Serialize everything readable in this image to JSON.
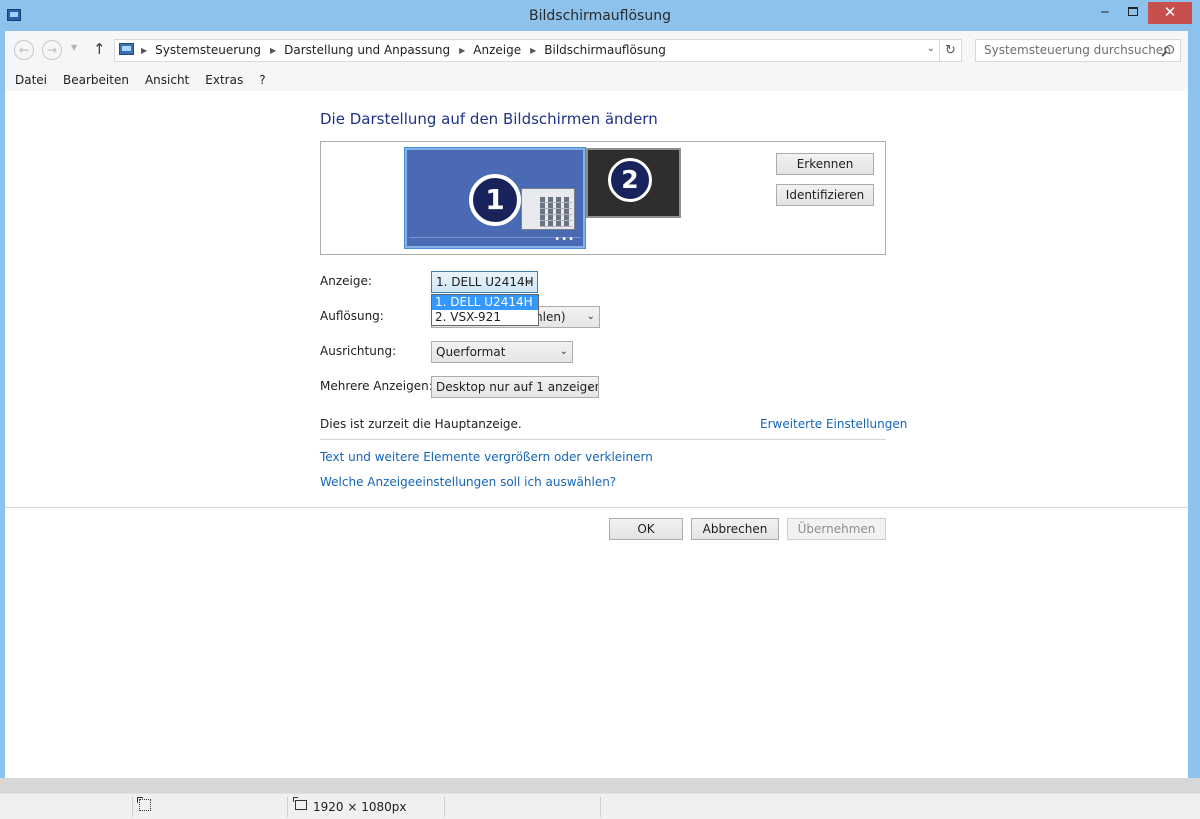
{
  "window": {
    "title": "Bildschirmauflösung",
    "minimize_glyph": "‒",
    "close_glyph": "✕"
  },
  "nav": {
    "back_glyph": "←",
    "forward_glyph": "→",
    "recent_glyph": "▼",
    "up_glyph": "↑",
    "breadcrumbs": [
      "Systemsteuerung",
      "Darstellung und Anpassung",
      "Anzeige",
      "Bildschirmauflösung"
    ],
    "breadcrumb_sep": "▶",
    "dropdown_glyph": "⌄",
    "refresh_glyph": "↻",
    "search_placeholder": "Systemsteuerung durchsuchen"
  },
  "menu": [
    "Datei",
    "Bearbeiten",
    "Ansicht",
    "Extras",
    "?"
  ],
  "main": {
    "heading": "Die Darstellung auf den Bildschirmen ändern",
    "monitor1_number": "1",
    "monitor2_number": "2",
    "monitor1_dots": "•••",
    "detect_button": "Erkennen",
    "identify_button": "Identifizieren",
    "display_label": "Anzeige:",
    "display_value": "1. DELL U2414H",
    "display_options": [
      "1. DELL U2414H",
      "2. VSX-921"
    ],
    "resolution_label": "Auflösung:",
    "resolution_visible": "hlen)",
    "orientation_label": "Ausrichtung:",
    "orientation_value": "Querformat",
    "multi_label": "Mehrere Anzeigen:",
    "multi_value": "Desktop nur auf 1 anzeigen",
    "status_text": "Dies ist zurzeit die Hauptanzeige.",
    "advanced_link": "Erweiterte Einstellungen",
    "text_size_link": "Text und weitere Elemente vergrößern oder verkleinern",
    "which_settings_link": "Welche Anzeigeeinstellungen soll ich auswählen?",
    "ok_button": "OK",
    "cancel_button": "Abbrechen",
    "apply_button": "Übernehmen",
    "combo_arrow": "⌄"
  },
  "statusbar": {
    "image_size": "1920 × 1080px"
  },
  "colors": {
    "title_bar": "#8cc2ec",
    "close_button": "#c7504d",
    "link": "#1565b8",
    "heading": "#1e3287",
    "selection": "#3399ff",
    "monitor1": "#4a6bb4"
  }
}
